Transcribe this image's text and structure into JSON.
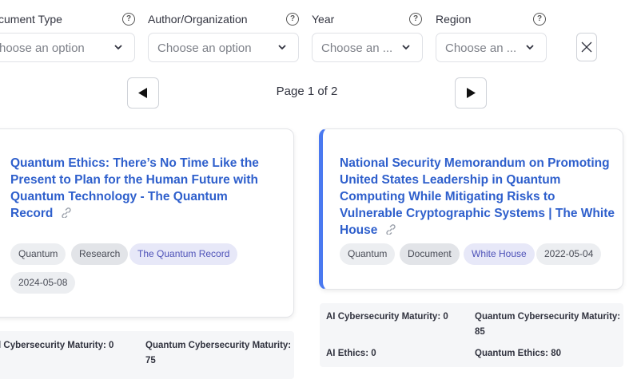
{
  "filters": [
    {
      "label": "cument Type",
      "value": "hoose an option"
    },
    {
      "label": "Author/Organization",
      "value": "Choose an option"
    },
    {
      "label": "Year",
      "value": "Choose an ..."
    },
    {
      "label": "Region",
      "value": "Choose an ..."
    }
  ],
  "help_glyph": "?",
  "pagination": {
    "label": "Page 1 of 2"
  },
  "cards": [
    {
      "title": "Quantum Ethics: There’s No Time Like the Present to Plan for the Human Future with Quantum Technology - The Quantum Record",
      "tags": {
        "topic": "Quantum",
        "type": "Research",
        "org": "The Quantum Record",
        "date": "2024-05-08"
      },
      "metrics": {
        "ai_cyber": "l Cybersecurity Maturity: 0",
        "q_cyber_label": "Quantum Cybersecurity Maturity:",
        "q_cyber_value": "75"
      }
    },
    {
      "title": "National Security Memorandum on Promoting United States Leadership in Quantum Computing While Mitigating Risks to Vulnerable Cryptographic Systems | The White House",
      "tags": {
        "topic": "Quantum",
        "type": "Document",
        "org": "White House",
        "date": "2022-05-04"
      },
      "metrics": {
        "ai_cyber": "AI Cybersecurity Maturity: 0",
        "q_cyber_label": "Quantum Cybersecurity Maturity:",
        "q_cyber_value": "85",
        "ai_ethics": "AI Ethics: 0",
        "q_ethics": "Quantum Ethics: 80"
      }
    }
  ],
  "colors": {
    "accent": "#4a79f0",
    "link": "#2e5fcc",
    "org_tag": "#4e52b8"
  }
}
